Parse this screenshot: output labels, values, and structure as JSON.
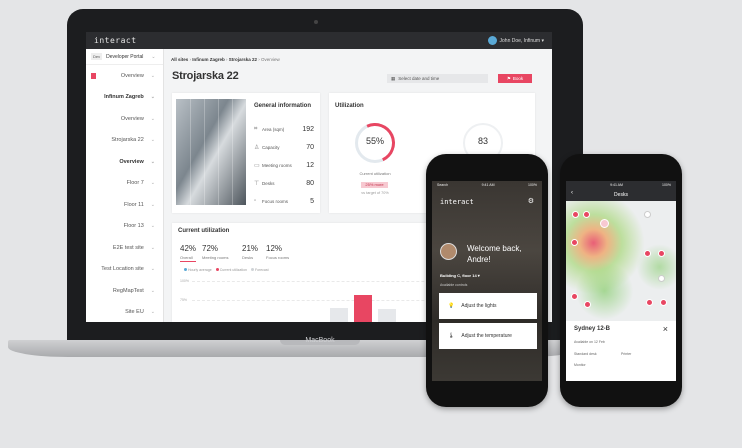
{
  "app": {
    "logo": "interact",
    "user": "John Doe, Infinum ▾",
    "laptop_brand": "MacBook"
  },
  "sidebar": {
    "portal_tag": "Dev",
    "portal": "Developer Portal",
    "items": [
      {
        "label": "Overview",
        "bold": false
      },
      {
        "label": "Infinum Zagreb",
        "bold": true
      },
      {
        "label": "Overview",
        "bold": false
      },
      {
        "label": "Strojarska 22",
        "bold": false
      },
      {
        "label": "Overview",
        "bold": true
      },
      {
        "label": "Floor 7",
        "bold": false
      },
      {
        "label": "Floor 11",
        "bold": false
      },
      {
        "label": "Floor 13",
        "bold": false
      },
      {
        "label": "E2E test site",
        "bold": false
      },
      {
        "label": "Test Location site",
        "bold": false
      },
      {
        "label": "RegMapTest",
        "bold": false
      },
      {
        "label": "Site EU",
        "bold": false
      }
    ]
  },
  "breadcrumb": {
    "a": "All sites",
    "b": "Infinum Zagreb",
    "c": "Strojarska 22",
    "d": "Overview"
  },
  "page_title": "Strojarska 22",
  "date_placeholder": "Select date and time",
  "book_label": "Book",
  "general": {
    "title": "General information",
    "rows": [
      {
        "icon": "⌗",
        "label": "Area (sqm)",
        "value": "192"
      },
      {
        "icon": "♙",
        "label": "Capacity",
        "value": "70"
      },
      {
        "icon": "▭",
        "label": "Meeting rooms",
        "value": "12"
      },
      {
        "icon": "⊤",
        "label": "Desks",
        "value": "80"
      },
      {
        "icon": "▫",
        "label": "Focus rooms",
        "value": "5"
      }
    ]
  },
  "utilization": {
    "title": "Utilization",
    "percent": "55%",
    "percent_value": 55,
    "caption": "Current utilization",
    "badge": "25% more",
    "target": "vs target of 70%",
    "second_value": "83"
  },
  "current": {
    "title": "Current utilization",
    "stats": [
      {
        "value": "42%",
        "label": "Overall"
      },
      {
        "value": "72%",
        "label": "Meeting rooms"
      },
      {
        "value": "21%",
        "label": "Desks"
      },
      {
        "value": "12%",
        "label": "Focus rooms"
      }
    ],
    "legend": [
      "Hourly average",
      "Current utilization",
      "Forecast"
    ],
    "yticks": [
      "100%",
      "75%"
    ],
    "colors": {
      "accent": "#e84662",
      "blue": "#5aa9d6",
      "grey": "#cfd3d7"
    }
  },
  "phone1": {
    "time": "9:41 AM",
    "carrier": "Search",
    "battery": "100%",
    "logo": "interact",
    "greeting": "Welcome back,",
    "name": "Andre!",
    "building": "Building C, floor 14 ▾",
    "controls_label": "Available controls",
    "btn_lights": "Adjust the lights",
    "btn_temp": "Adjust the temperature"
  },
  "phone2": {
    "time": "9:41 AM",
    "battery": "100%",
    "title": "Desks",
    "desk": "Sydney 12-B",
    "rows": [
      "Available on 12 Feb",
      "Standard desk",
      "Printer",
      "Monitor"
    ]
  }
}
